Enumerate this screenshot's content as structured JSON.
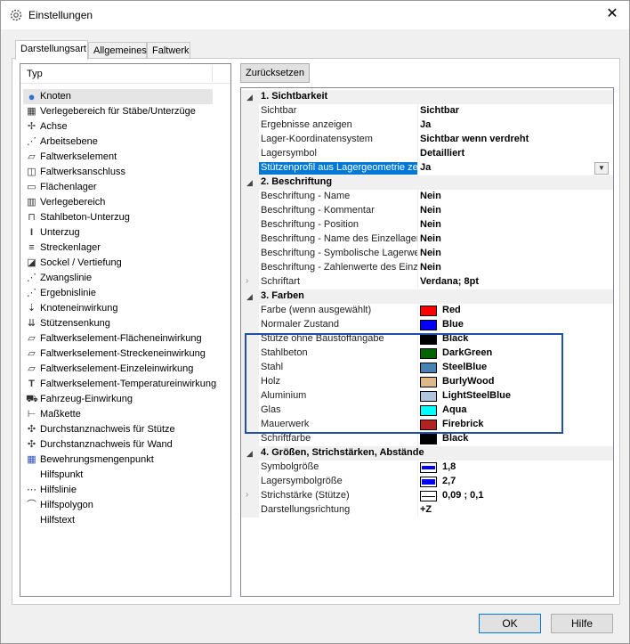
{
  "window": {
    "title": "Einstellungen",
    "close_label": "✕"
  },
  "tabs": [
    {
      "label": "Darstellungsart"
    },
    {
      "label": "Allgemeines"
    },
    {
      "label": "Faltwerk"
    }
  ],
  "typelist": {
    "header": "Typ",
    "items": [
      {
        "label": "Knoten",
        "icon": "●"
      },
      {
        "label": "Verlegebereich für Stäbe/Unterzüge",
        "icon": "▦"
      },
      {
        "label": "Achse",
        "icon": "✢"
      },
      {
        "label": "Arbeitsebene",
        "icon": "⋰"
      },
      {
        "label": "Faltwerkselement",
        "icon": "▱"
      },
      {
        "label": "Faltwerksanschluss",
        "icon": "◫"
      },
      {
        "label": "Flächenlager",
        "icon": "▭"
      },
      {
        "label": "Verlegebereich",
        "icon": "▥"
      },
      {
        "label": "Stahlbeton-Unterzug",
        "icon": "⊓"
      },
      {
        "label": "Unterzug",
        "icon": "I"
      },
      {
        "label": "Streckenlager",
        "icon": "≡"
      },
      {
        "label": "Sockel / Vertiefung",
        "icon": "◪"
      },
      {
        "label": "Zwangslinie",
        "icon": "⋰"
      },
      {
        "label": "Ergebnislinie",
        "icon": "⋰"
      },
      {
        "label": "Knoteneinwirkung",
        "icon": "⇣"
      },
      {
        "label": "Stützensenkung",
        "icon": "⇊"
      },
      {
        "label": "Faltwerkselement-Flächeneinwirkung",
        "icon": "▱"
      },
      {
        "label": "Faltwerkselement-Streckeneinwirkung",
        "icon": "▱"
      },
      {
        "label": "Faltwerkselement-Einzeleinwirkung",
        "icon": "▱"
      },
      {
        "label": "Faltwerkselement-Temperatureinwirkung",
        "icon": "T"
      },
      {
        "label": "Fahrzeug-Einwirkung",
        "icon": "⛟"
      },
      {
        "label": "Maßkette",
        "icon": "⊢"
      },
      {
        "label": "Durchstanznachweis für Stütze",
        "icon": "✣"
      },
      {
        "label": "Durchstanznachweis für Wand",
        "icon": "✣"
      },
      {
        "label": "Bewehrungsmengenpunkt",
        "icon": "▦"
      },
      {
        "label": "Hilfspunkt",
        "icon": ""
      },
      {
        "label": "Hilfslinie",
        "icon": "⋯"
      },
      {
        "label": "Hilfspolygon",
        "icon": "⌒"
      },
      {
        "label": "Hilfstext",
        "icon": ""
      }
    ]
  },
  "reset_button": "Zurücksetzen",
  "categories": {
    "c1": "1. Sichtbarkeit",
    "c2": "2. Beschriftung",
    "c3": "3. Farben",
    "c4": "4. Größen, Strichstärken, Abstände"
  },
  "props": {
    "sichtbar": {
      "name": "Sichtbar",
      "value": "Sichtbar"
    },
    "ergebnisse": {
      "name": "Ergebnisse anzeigen",
      "value": "Ja"
    },
    "lagerkoord": {
      "name": "Lager-Koordinatensystem",
      "value": "Sichtbar wenn verdreht"
    },
    "lagersymbol": {
      "name": "Lagersymbol",
      "value": "Detailliert"
    },
    "stuetzenprofil": {
      "name": "Stützenprofil aus Lagergeometrie zeichnen",
      "value": "Ja"
    },
    "b_name": {
      "name": "Beschriftung - Name",
      "value": "Nein"
    },
    "b_kommentar": {
      "name": "Beschriftung - Kommentar",
      "value": "Nein"
    },
    "b_position": {
      "name": "Beschriftung - Position",
      "value": "Nein"
    },
    "b_einzellager": {
      "name": "Beschriftung - Name des Einzellagers",
      "value": "Nein"
    },
    "b_symbolisch": {
      "name": "Beschriftung - Symbolische Lagerwerte",
      "value": "Nein"
    },
    "b_zahlen": {
      "name": "Beschriftung - Zahlenwerte des Einzellagers",
      "value": "Nein"
    },
    "schriftart": {
      "name": "Schriftart",
      "value": "Verdana; 8pt"
    },
    "f_auswahl": {
      "name": "Farbe (wenn ausgewählt)",
      "value": "Red",
      "color": "#ff0000"
    },
    "f_normal": {
      "name": "Normaler Zustand",
      "value": "Blue",
      "color": "#0000ff"
    },
    "f_stuetze": {
      "name": "Stütze ohne Baustoffangabe",
      "value": "Black",
      "color": "#000000"
    },
    "f_stahlbeton": {
      "name": "Stahlbeton",
      "value": "DarkGreen",
      "color": "#006400"
    },
    "f_stahl": {
      "name": "Stahl",
      "value": "SteelBlue",
      "color": "#4682b4"
    },
    "f_holz": {
      "name": "Holz",
      "value": "BurlyWood",
      "color": "#deb887"
    },
    "f_alu": {
      "name": "Aluminium",
      "value": "LightSteelBlue",
      "color": "#b0c4de"
    },
    "f_glas": {
      "name": "Glas",
      "value": "Aqua",
      "color": "#00ffff"
    },
    "f_mauerwerk": {
      "name": "Mauerwerk",
      "value": "Firebrick",
      "color": "#b22222"
    },
    "f_schrift": {
      "name": "Schriftfarbe",
      "value": "Black",
      "color": "#000000"
    },
    "symbolgroesse": {
      "name": "Symbolgröße",
      "value": "1,8"
    },
    "lagersymbolgroesse": {
      "name": "Lagersymbolgröße",
      "value": "2,7"
    },
    "strichstaerke": {
      "name": "Strichstärke (Stütze)",
      "value": "0,09 ; 0,1"
    },
    "darstellungsrichtung": {
      "name": "Darstellungsrichtung",
      "value": "+Z"
    }
  },
  "buttons": {
    "ok": "OK",
    "help": "Hilfe"
  }
}
